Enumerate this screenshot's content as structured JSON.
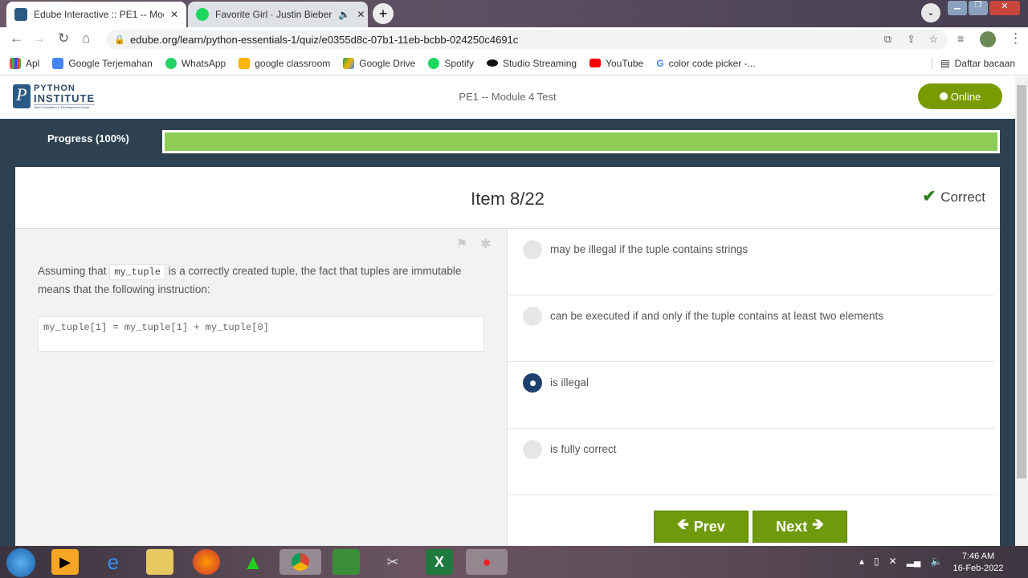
{
  "browser": {
    "tabs": [
      {
        "title": "Edube Interactive :: PE1 -- Modul",
        "active": true
      },
      {
        "title": "Favorite Girl · Justin Bieber",
        "active": false
      }
    ],
    "url": "edube.org/learn/python-essentials-1/quiz/e0355d8c-07b1-11eb-bcbb-024250c4691c",
    "bookmarks": [
      "Apl",
      "Google Terjemahan",
      "WhatsApp",
      "google classroom",
      "Google Drive",
      "Spotify",
      "Studio Streaming",
      "YouTube",
      "color code picker -..."
    ],
    "reading_list": "Daftar bacaan"
  },
  "site": {
    "logo_line1": "PYTHON",
    "logo_line2": "INSTITUTE",
    "logo_tagline": "Open Education & Development Group",
    "title": "PE1 -- Module 4 Test",
    "status": "Online"
  },
  "progress": {
    "label": "Progress (100%)",
    "value": 100,
    "color": "#8ecd55"
  },
  "item": {
    "label": "Item 8/22",
    "result": "Correct"
  },
  "question": {
    "before": "Assuming that",
    "code_inline": "my_tuple",
    "after": "is a correctly created tuple, the fact that tuples are immutable means that the following instruction:",
    "code": "my_tuple[1] = my_tuple[1] + my_tuple[0]"
  },
  "answers": [
    {
      "text": "may be illegal if the tuple contains strings",
      "selected": false
    },
    {
      "text": "can be executed if and only if the tuple contains at least two elements",
      "selected": false
    },
    {
      "text": "is illegal",
      "selected": true
    },
    {
      "text": "is fully correct",
      "selected": false
    }
  ],
  "nav": {
    "prev": "Prev",
    "next": "Next"
  },
  "taskbar": {
    "time": "7:46 AM",
    "date": "16-Feb-2022"
  },
  "colors": {
    "accent": "#7a9a01",
    "header_bg": "#2e4150",
    "selected_radio": "#1d3f6e",
    "correct": "#2e7d1a"
  }
}
